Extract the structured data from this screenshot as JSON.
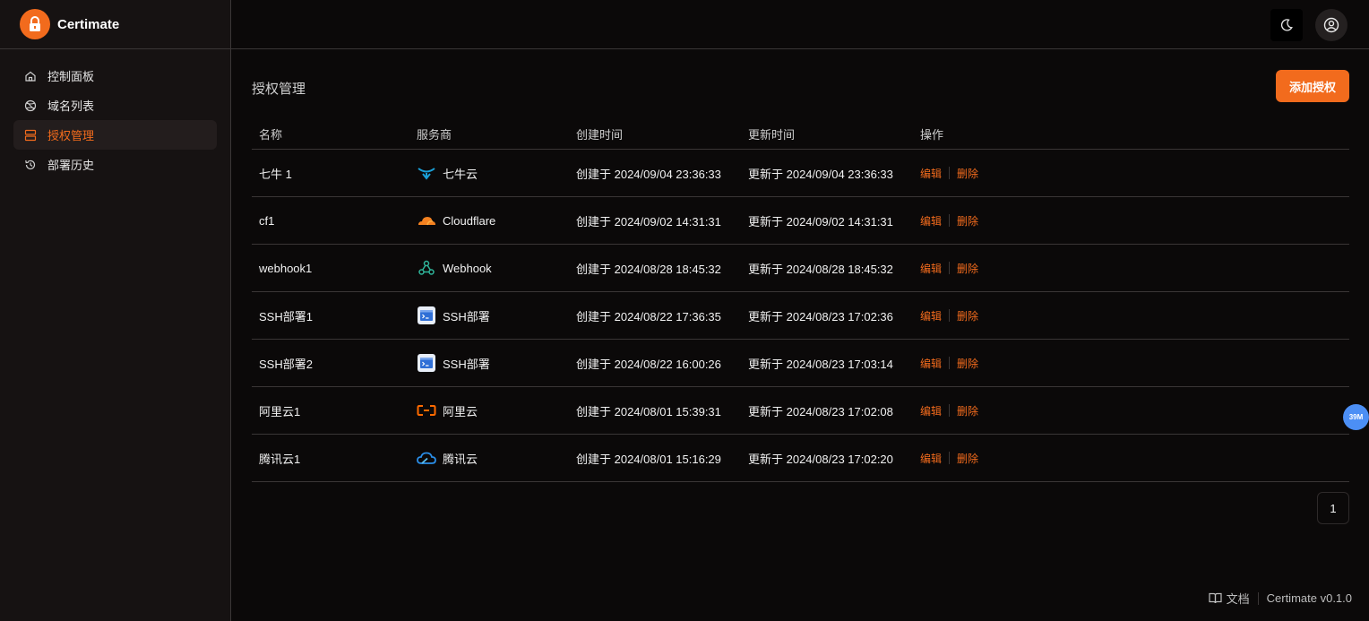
{
  "app": {
    "name": "Certimate",
    "accent": "#f26b1d"
  },
  "sidebar": {
    "items": [
      {
        "label": "控制面板",
        "icon": "home-icon",
        "active": false
      },
      {
        "label": "域名列表",
        "icon": "globe-off-icon",
        "active": false
      },
      {
        "label": "授权管理",
        "icon": "server-icon",
        "active": true
      },
      {
        "label": "部署历史",
        "icon": "history-icon",
        "active": false
      }
    ]
  },
  "header": {
    "theme_icon": "moon-icon",
    "user_icon": "user-circle-icon"
  },
  "main": {
    "title": "授权管理",
    "add_button": "添加授权",
    "columns": [
      "名称",
      "服务商",
      "创建时间",
      "更新时间",
      "操作"
    ],
    "rows": [
      {
        "name": "七牛 1",
        "provider": "七牛云",
        "provider_icon": "qiniu-icon",
        "created": "创建于 2024/09/04 23:36:33",
        "updated": "更新于 2024/09/04 23:36:33",
        "edit": "编辑",
        "delete": "删除"
      },
      {
        "name": "cf1",
        "provider": "Cloudflare",
        "provider_icon": "cloudflare-icon",
        "created": "创建于 2024/09/02 14:31:31",
        "updated": "更新于 2024/09/02 14:31:31",
        "edit": "编辑",
        "delete": "删除"
      },
      {
        "name": "webhook1",
        "provider": "Webhook",
        "provider_icon": "webhook-icon",
        "created": "创建于 2024/08/28 18:45:32",
        "updated": "更新于 2024/08/28 18:45:32",
        "edit": "编辑",
        "delete": "删除"
      },
      {
        "name": "SSH部署1",
        "provider": "SSH部署",
        "provider_icon": "ssh-icon",
        "created": "创建于 2024/08/22 17:36:35",
        "updated": "更新于 2024/08/23 17:02:36",
        "edit": "编辑",
        "delete": "删除"
      },
      {
        "name": "SSH部署2",
        "provider": "SSH部署",
        "provider_icon": "ssh-icon",
        "created": "创建于 2024/08/22 16:00:26",
        "updated": "更新于 2024/08/23 17:03:14",
        "edit": "编辑",
        "delete": "删除"
      },
      {
        "name": "阿里云1",
        "provider": "阿里云",
        "provider_icon": "aliyun-icon",
        "created": "创建于 2024/08/01 15:39:31",
        "updated": "更新于 2024/08/23 17:02:08",
        "edit": "编辑",
        "delete": "删除"
      },
      {
        "name": "腾讯云1",
        "provider": "腾讯云",
        "provider_icon": "tencent-cloud-icon",
        "created": "创建于 2024/08/01 15:16:29",
        "updated": "更新于 2024/08/23 17:02:20",
        "edit": "编辑",
        "delete": "删除"
      }
    ],
    "pagination": {
      "current_page": "1"
    }
  },
  "float_badge": "39M",
  "footer": {
    "docs_label": "文档",
    "version": "Certimate v0.1.0"
  }
}
